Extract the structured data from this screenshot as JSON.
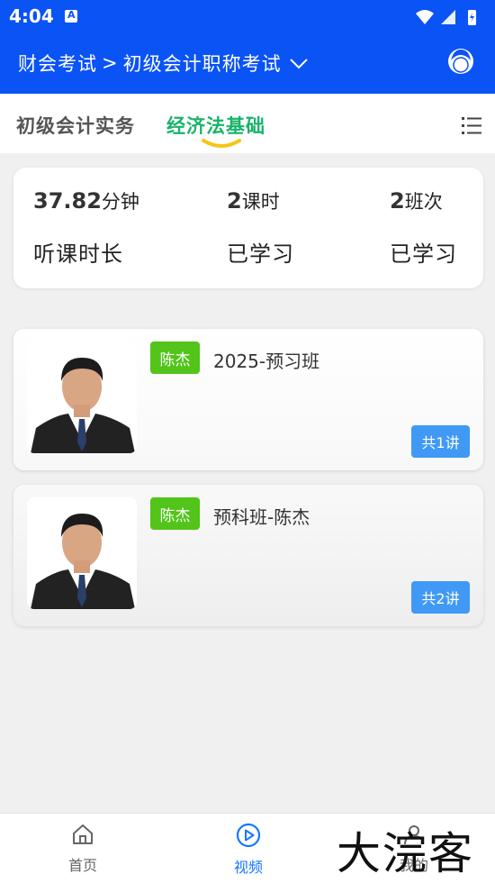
{
  "status_bar": {
    "time": "4:04",
    "notification_icon": "a-notification-icon"
  },
  "header": {
    "breadcrumb_exam": "财会考试",
    "breadcrumb_sep": ">",
    "breadcrumb_level": "初级会计职称考试",
    "dropdown_icon": "chevron-down-icon",
    "service_icon": "customer-service-icon"
  },
  "subjects": {
    "tabs": [
      {
        "label": "初级会计实务",
        "active": false
      },
      {
        "label": "经济法基础",
        "active": true
      }
    ],
    "menu_icon": "list-menu-icon"
  },
  "stats": {
    "duration": {
      "value": "37.82",
      "unit": "分钟",
      "label": "听课时长"
    },
    "lessons": {
      "value": "2",
      "unit": "课时",
      "label": "已学习"
    },
    "classes": {
      "value": "2",
      "unit": "班次",
      "label": "已学习"
    }
  },
  "courses": [
    {
      "teacher": "陈杰",
      "title": "2025-预习班",
      "lessons": "共1讲"
    },
    {
      "teacher": "陈杰",
      "title": "预科班-陈杰",
      "lessons": "共2讲"
    }
  ],
  "bottom_nav": {
    "items": [
      {
        "label": "首页",
        "icon": "home-icon",
        "active": false
      },
      {
        "label": "视频",
        "icon": "play-circle-icon",
        "active": true
      },
      {
        "label": "我的",
        "icon": "user-icon",
        "active": false
      }
    ]
  },
  "watermark": "大浣客",
  "colors": {
    "primary": "#0a53f5",
    "active_tab": "#19b36b",
    "teacher_tag": "#52c41a",
    "lesson_badge": "#3f99f5",
    "nav_active": "#1677ff"
  }
}
